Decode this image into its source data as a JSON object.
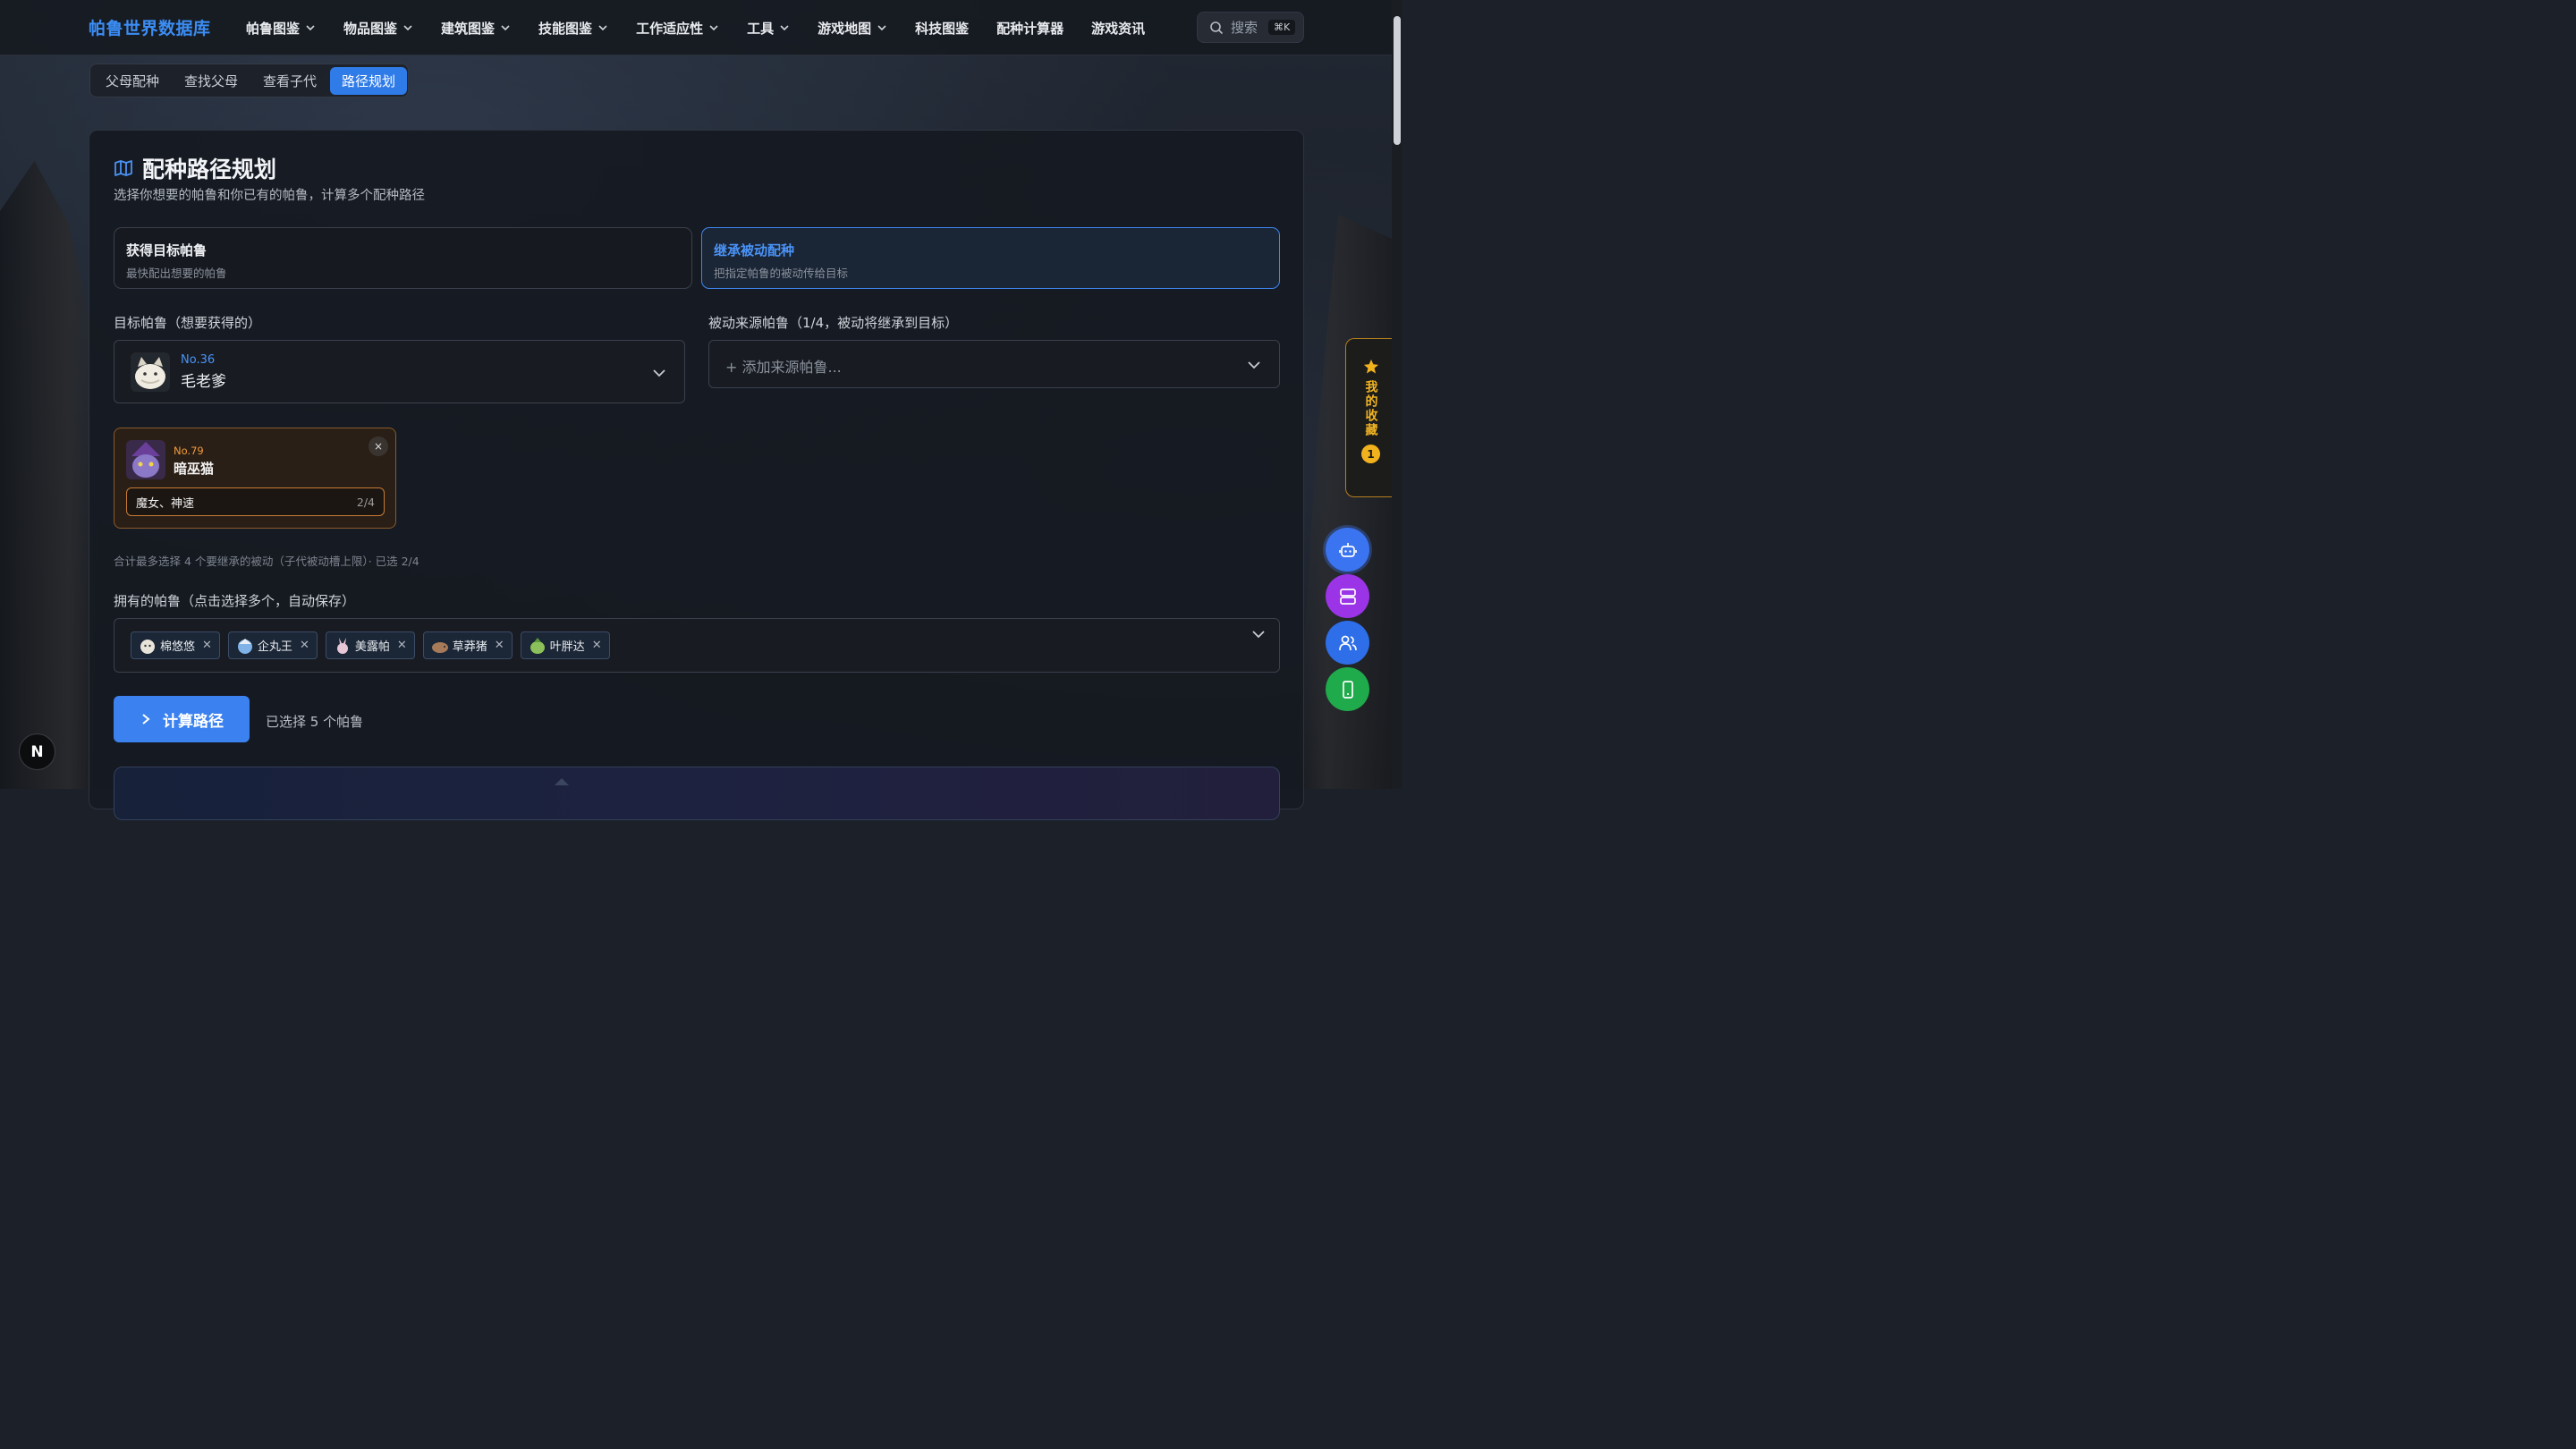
{
  "header": {
    "logo": "帕鲁世界数据库",
    "nav": [
      {
        "label": "帕鲁图鉴",
        "dropdown": true
      },
      {
        "label": "物品图鉴",
        "dropdown": true
      },
      {
        "label": "建筑图鉴",
        "dropdown": true
      },
      {
        "label": "技能图鉴",
        "dropdown": true
      },
      {
        "label": "工作适应性",
        "dropdown": true
      },
      {
        "label": "工具",
        "dropdown": true
      },
      {
        "label": "游戏地图",
        "dropdown": true
      },
      {
        "label": "科技图鉴",
        "dropdown": false
      },
      {
        "label": "配种计算器",
        "dropdown": false
      },
      {
        "label": "游戏资讯",
        "dropdown": false
      }
    ],
    "search_label": "搜索",
    "search_shortcut": "⌘K"
  },
  "tabs": [
    {
      "label": "父母配种",
      "active": false
    },
    {
      "label": "查找父母",
      "active": false
    },
    {
      "label": "查看子代",
      "active": false
    },
    {
      "label": "路径规划",
      "active": true
    }
  ],
  "main": {
    "title": "配种路径规划",
    "subtitle": "选择你想要的帕鲁和你已有的帕鲁，计算多个配种路径",
    "modes": [
      {
        "title": "获得目标帕鲁",
        "desc": "最快配出想要的帕鲁",
        "active": false
      },
      {
        "title": "继承被动配种",
        "desc": "把指定帕鲁的被动传给目标",
        "active": true
      }
    ],
    "target_label": "目标帕鲁（想要获得的）",
    "target": {
      "no": "No.36",
      "name": "毛老爹"
    },
    "source_label": "被动来源帕鲁（1/4，被动将继承到目标）",
    "source_placeholder": "+ 添加来源帕鲁...",
    "source_card": {
      "no": "No.79",
      "name": "暗巫猫",
      "close": "×",
      "passives": "魔女、神速",
      "passive_count": "2/4"
    },
    "hint": "合计最多选择 4 个要继承的被动（子代被动槽上限）· 已选 2/4",
    "owned_label": "拥有的帕鲁（点击选择多个，自动保存）",
    "owned": [
      {
        "name": "棉悠悠",
        "color": "#e9e4da"
      },
      {
        "name": "企丸王",
        "color": "#7fb2e6"
      },
      {
        "name": "美露帕",
        "color": "#e7c6d6"
      },
      {
        "name": "草莽猪",
        "color": "#a77a5a"
      },
      {
        "name": "叶胖达",
        "color": "#8cc05a"
      }
    ],
    "calc_button": "计算路径",
    "selected_count": "已选择 5 个帕鲁"
  },
  "sidebar": {
    "favorites_label": "我的收藏",
    "favorites_count": "1"
  },
  "dev_badge": "N",
  "colors": {
    "accent": "#3b82f0",
    "favorite": "#f2b21e",
    "fab_robot": "#3b74f0",
    "fab_server": "#9b34e6",
    "fab_users": "#2e6ee8",
    "fab_mobile": "#1faa4b"
  }
}
